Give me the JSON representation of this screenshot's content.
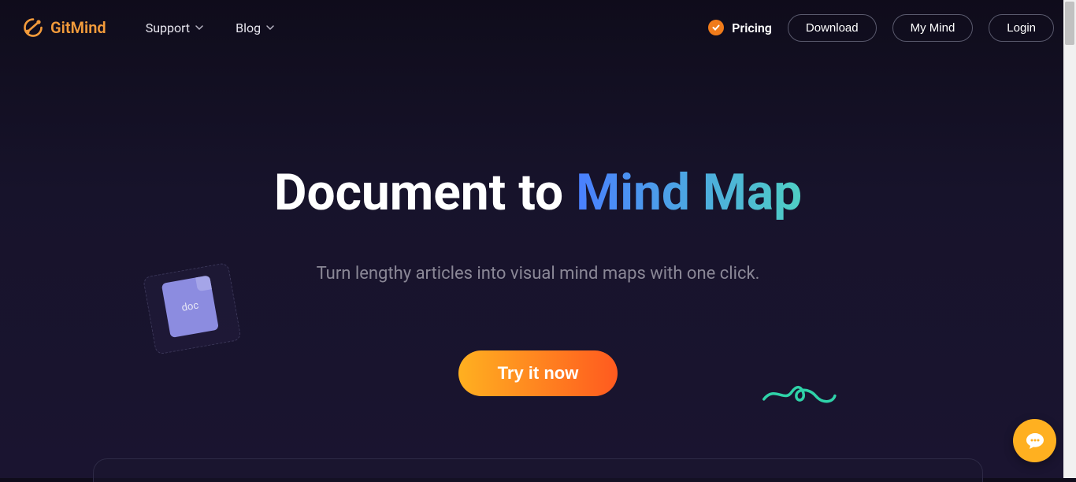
{
  "header": {
    "logo_text": "GitMind",
    "nav": {
      "support": "Support",
      "blog": "Blog"
    },
    "pricing": "Pricing",
    "download": "Download",
    "my_mind": "My Mind",
    "login": "Login"
  },
  "hero": {
    "title_part1": "Document to ",
    "title_part2": "Mind Map",
    "subtitle": "Turn lengthy articles into visual mind maps with one click.",
    "cta": "Try it now",
    "doc_label": "doc"
  }
}
